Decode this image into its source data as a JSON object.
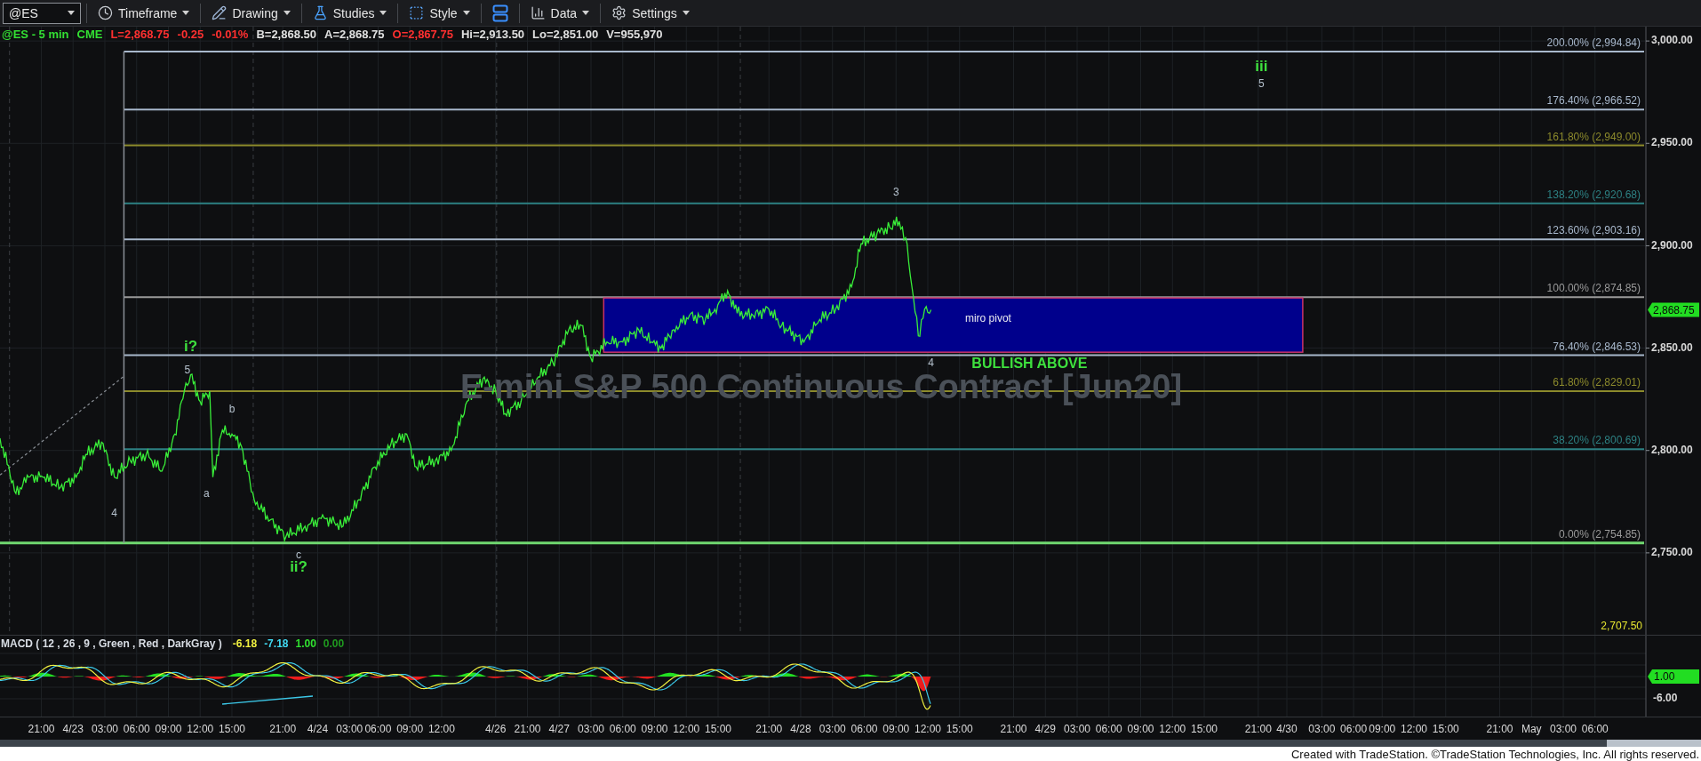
{
  "toolbar": {
    "symbol": {
      "value": "@ES"
    },
    "buttons": [
      {
        "kind": "timeframe",
        "label": "Timeframe"
      },
      {
        "kind": "drawing",
        "label": "Drawing"
      },
      {
        "kind": "studies",
        "label": "Studies"
      },
      {
        "kind": "style",
        "label": "Style"
      },
      {
        "kind": "layout"
      },
      {
        "kind": "data",
        "label": "Data"
      },
      {
        "kind": "settings",
        "label": "Settings"
      }
    ]
  },
  "quote": [
    {
      "text": "@ES - 5 min",
      "color": "#33e033"
    },
    {
      "text": "CME",
      "color": "#33e033"
    },
    {
      "text": "L=2,868.75",
      "color": "#ff3030"
    },
    {
      "text": "-0.25",
      "color": "#ff3030"
    },
    {
      "text": "-0.01%",
      "color": "#ff3030"
    },
    {
      "text": "B=2,868.50",
      "color": "#e0e0e0"
    },
    {
      "text": "A=2,868.75",
      "color": "#e0e0e0"
    },
    {
      "text": "O=2,867.75",
      "color": "#ff3030"
    },
    {
      "text": "Hi=2,913.50",
      "color": "#e0e0e0"
    },
    {
      "text": "Lo=2,851.00",
      "color": "#e0e0e0"
    },
    {
      "text": "V=955,970",
      "color": "#e0e0e0"
    }
  ],
  "price_chart": {
    "watermark": "E-mini S&P 500 Continuous Contract [Jun20]",
    "fib_levels": [
      {
        "label": "200.00% (2,994.84)",
        "color": "#a8b8cc"
      },
      {
        "label": "176.40% (2,966.52)",
        "color": "#a8b8cc"
      },
      {
        "label": "161.80% (2,949.00)",
        "color": "#8c8a2c"
      },
      {
        "label": "138.20% (2,920.68)",
        "color": "#2d8183"
      },
      {
        "label": "123.60% (2,903.16)",
        "color": "#a8b8cc"
      },
      {
        "label": "100.00% (2,874.85)",
        "color": "#9a9a9a"
      },
      {
        "label": "76.40% (2,846.53)",
        "color": "#a8b8cc"
      },
      {
        "label": "61.80% (2,829.01)",
        "color": "#8c8a2c"
      },
      {
        "label": "38.20% (2,800.69)",
        "color": "#2d8183"
      },
      {
        "label": "0.00% (2,754.85)",
        "color": "#9a9a9a"
      }
    ],
    "labels": [
      {
        "kind": "wave",
        "text": "iii"
      },
      {
        "kind": "count",
        "text": "5"
      },
      {
        "kind": "count",
        "text": "3"
      },
      {
        "kind": "note",
        "text": "miro pivot"
      },
      {
        "kind": "count",
        "text": "4"
      },
      {
        "kind": "callout",
        "text": "BULLISH ABOVE"
      },
      {
        "kind": "wave",
        "text": "i?"
      },
      {
        "kind": "count",
        "text": "5"
      },
      {
        "kind": "count",
        "text": "b"
      },
      {
        "kind": "count",
        "text": "a"
      },
      {
        "kind": "count",
        "text": "4"
      },
      {
        "kind": "count",
        "text": "c"
      },
      {
        "kind": "wave",
        "text": "ii?"
      }
    ],
    "price_axis": [
      "3,000.00",
      "2,950.00",
      "2,900.00",
      "2,850.00",
      "2,800.00",
      "2,750.00"
    ],
    "last_price": "2,868.75",
    "axis_note": "2,707.50"
  },
  "macd": {
    "title": "MACD ( 12 , 26 , 9 , Green , Red , DarkGray )",
    "values": [
      {
        "text": "-6.18",
        "color": "#f0f040"
      },
      {
        "text": "-7.18",
        "color": "#40d8f0"
      },
      {
        "text": "1.00",
        "color": "#30e030"
      },
      {
        "text": "0.00",
        "color": "#1f9a1f"
      }
    ],
    "axis_labels": [
      {
        "kind": "marker",
        "text": "1.00"
      },
      {
        "kind": "tick",
        "text": "-6.00"
      }
    ]
  },
  "time_axis": [
    "21:00",
    "4/23",
    "03:00",
    "06:00",
    "09:00",
    "12:00",
    "15:00",
    "21:00",
    "4/24",
    "03:00",
    "06:00",
    "09:00",
    "12:00",
    "4/26",
    "21:00",
    "4/27",
    "03:00",
    "06:00",
    "09:00",
    "12:00",
    "15:00",
    "21:00",
    "4/28",
    "03:00",
    "06:00",
    "09:00",
    "12:00",
    "15:00",
    "21:00",
    "4/29",
    "03:00",
    "06:00",
    "09:00",
    "12:00",
    "15:00",
    "21:00",
    "4/30",
    "03:00",
    "06:00",
    "09:00",
    "12:00",
    "15:00",
    "21:00",
    "May",
    "03:00",
    "06:00"
  ],
  "footer": "Created with TradeStation. ©TradeStation Technologies, Inc. All rights reserved."
}
